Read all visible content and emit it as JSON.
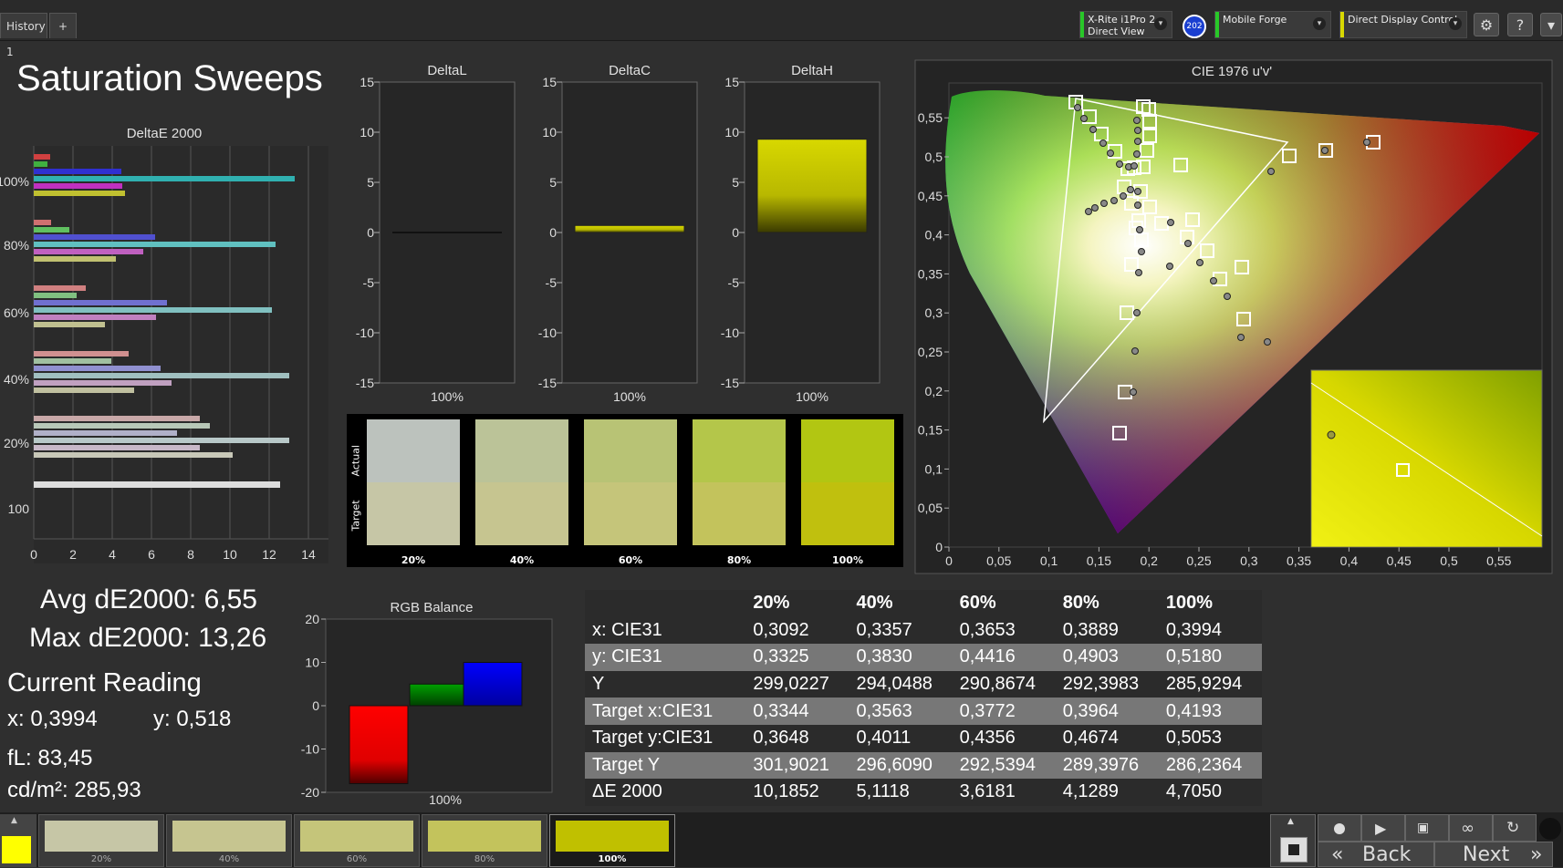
{
  "tabs": {
    "history": "History 1",
    "add": "+"
  },
  "toolbar": {
    "device1_line1": "X-Rite i1Pro 2",
    "device1_line2": "Direct View",
    "device1_badge": "202",
    "device2": "Mobile Forge",
    "device3": "Direct Display Control",
    "gear": "⚙",
    "help": "?",
    "dropdown": "▾"
  },
  "page_title": "Saturation Sweeps",
  "colors": {
    "accent_yellow": "#c8c800",
    "green_indicator": "#28c828",
    "yellow_indicator": "#d8d800",
    "red": "#ff0000",
    "green": "#008000",
    "blue": "#0000ff"
  },
  "deltae_chart": {
    "title": "DeltaE 2000",
    "y_labels": [
      "100%",
      "80%",
      "60%",
      "40%",
      "20%",
      "100"
    ],
    "x_ticks": [
      "0",
      "2",
      "4",
      "6",
      "8",
      "10",
      "12",
      "14"
    ]
  },
  "delta_charts": [
    {
      "title": "DeltaL",
      "value": 0.0,
      "label": "100%"
    },
    {
      "title": "DeltaC",
      "value": 0.7,
      "label": "100%"
    },
    {
      "title": "DeltaH",
      "value": 9.3,
      "label": "100%"
    }
  ],
  "delta_y_ticks": [
    "15",
    "10",
    "5",
    "0",
    "-5",
    "-10",
    "-15"
  ],
  "swatches": {
    "actual_label": "Actual",
    "target_label": "Target",
    "items": [
      {
        "label": "20%",
        "actual": "#bcc2bd",
        "target": "#c6c6a6"
      },
      {
        "label": "40%",
        "actual": "#bbc398",
        "target": "#c6c590"
      },
      {
        "label": "60%",
        "actual": "#b8c375",
        "target": "#c5c57a"
      },
      {
        "label": "80%",
        "actual": "#b4c64a",
        "target": "#c3c35c"
      },
      {
        "label": "100%",
        "actual": "#b2c612",
        "target": "#c0c00e"
      }
    ]
  },
  "cie": {
    "title": "CIE 1976 u'v'",
    "x_ticks": [
      "0",
      "0,05",
      "0,1",
      "0,15",
      "0,2",
      "0,25",
      "0,3",
      "0,35",
      "0,4",
      "0,45",
      "0,5",
      "0,55"
    ],
    "y_ticks": [
      "0",
      "0,05",
      "0,1",
      "0,15",
      "0,2",
      "0,25",
      "0,3",
      "0,35",
      "0,4",
      "0,45",
      "0,5",
      "0,55"
    ]
  },
  "stats": {
    "avg": "Avg dE2000: 6,55",
    "max": "Max dE2000: 13,26",
    "current_reading": "Current Reading",
    "x": "x: 0,3994",
    "y": "y: 0,518",
    "fl": "fL: 83,45",
    "cdm2": "cd/m²: 285,93"
  },
  "rgb_balance": {
    "title": "RGB Balance",
    "y_ticks": [
      "20",
      "10",
      "0",
      "-10",
      "-20"
    ],
    "values": [
      -18,
      5,
      10
    ],
    "label": "100%"
  },
  "table": {
    "headers": [
      "",
      "20%",
      "40%",
      "60%",
      "80%",
      "100%"
    ],
    "rows": [
      [
        "x: CIE31",
        "0,3092",
        "0,3357",
        "0,3653",
        "0,3889",
        "0,3994"
      ],
      [
        "y: CIE31",
        "0,3325",
        "0,3830",
        "0,4416",
        "0,4903",
        "0,5180"
      ],
      [
        "Y",
        "299,0227",
        "294,0488",
        "290,8674",
        "292,3983",
        "285,9294"
      ],
      [
        "Target x:CIE31",
        "0,3344",
        "0,3563",
        "0,3772",
        "0,3964",
        "0,4193"
      ],
      [
        "Target y:CIE31",
        "0,3648",
        "0,4011",
        "0,4356",
        "0,4674",
        "0,5053"
      ],
      [
        "Target Y",
        "301,9021",
        "296,6090",
        "292,5394",
        "289,3976",
        "286,2364"
      ],
      [
        "ΔE 2000",
        "10,1852",
        "5,1118",
        "3,6181",
        "4,1289",
        "4,7050"
      ]
    ]
  },
  "bottom_swatches": [
    {
      "label": "20%",
      "color": "#c6c6a6"
    },
    {
      "label": "40%",
      "color": "#c6c590"
    },
    {
      "label": "60%",
      "color": "#c5c57a"
    },
    {
      "label": "80%",
      "color": "#c3c35c"
    },
    {
      "label": "100%",
      "color": "#c0c000"
    }
  ],
  "nav": {
    "back": "Back",
    "next": "Next",
    "back_arrows": "«",
    "next_arrows": "»"
  }
}
